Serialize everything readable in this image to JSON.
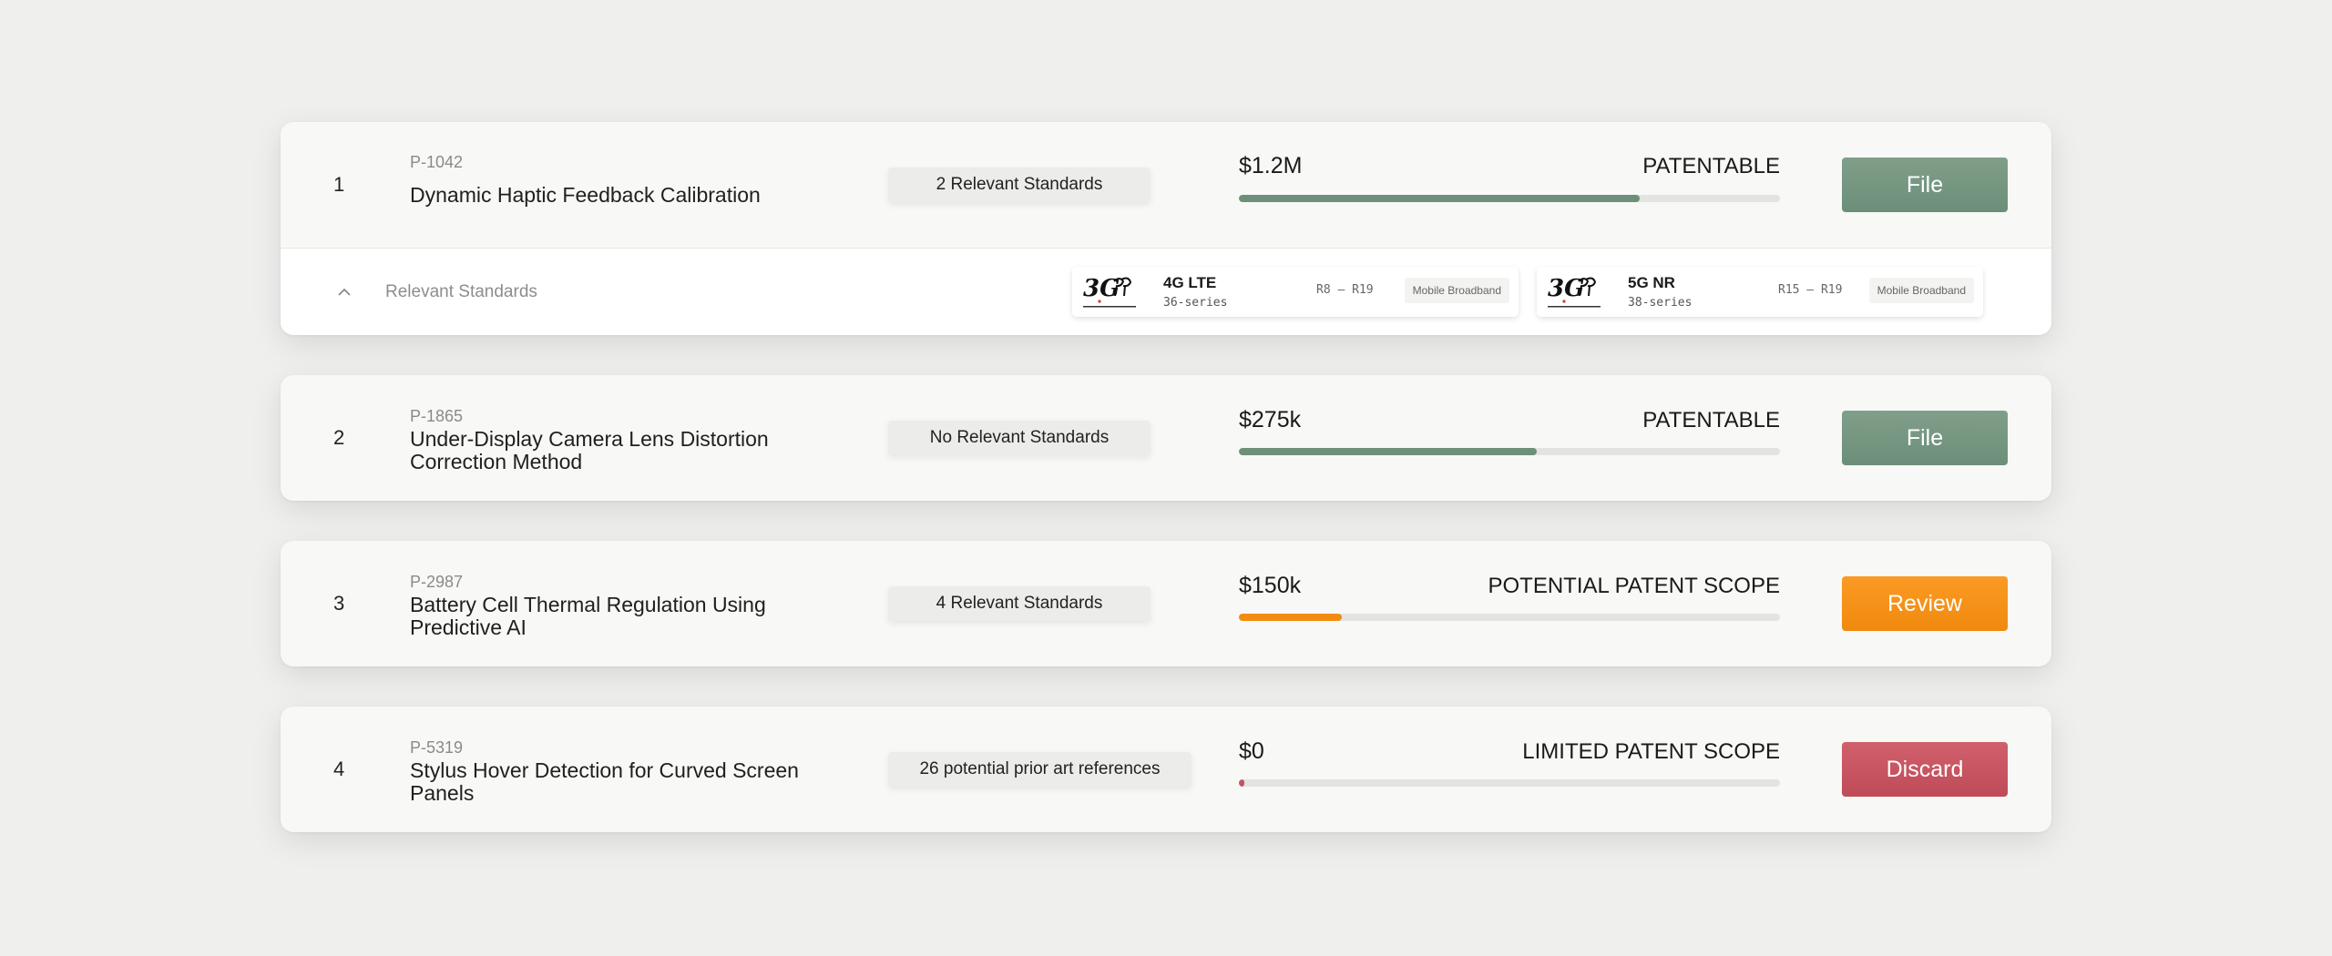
{
  "rows": [
    {
      "rank": "1",
      "id": "P-1042",
      "title": "Dynamic Haptic Feedback Calibration",
      "standards": "2 Relevant Standards",
      "value": "$1.2M",
      "verdict": "PATENTABLE",
      "progress": 0.74,
      "action": "File",
      "accent": "#6e8f79"
    },
    {
      "rank": "2",
      "id": "P-1865",
      "title": "Under-Display Camera Lens Distortion Correction Method",
      "standards": "No Relevant Standards",
      "value": "$275k",
      "verdict": "PATENTABLE",
      "progress": 0.55,
      "action": "File",
      "accent": "#6e8f79"
    },
    {
      "rank": "3",
      "id": "P-2987",
      "title": "Battery Cell Thermal Regulation Using Predictive AI",
      "standards": "4 Relevant Standards",
      "value": "$150k",
      "verdict": "POTENTIAL PATENT SCOPE",
      "progress": 0.19,
      "action": "Review",
      "accent": "#f28c10"
    },
    {
      "rank": "4",
      "id": "P-5319",
      "title": "Stylus Hover Detection for Curved Screen Panels",
      "standards": "26 potential prior art references",
      "value": "$0",
      "verdict": "LIMITED PATENT SCOPE",
      "progress": 0.01,
      "action": "Discard",
      "accent": "#c65462"
    }
  ],
  "expanded": {
    "label": "Relevant Standards",
    "icon": "chevron-up-icon",
    "standards": [
      {
        "logo": "3GPP",
        "name": "4G LTE",
        "series": "36-series",
        "range": "R8 – R19",
        "tag": "Mobile Broadband"
      },
      {
        "logo": "3GPP",
        "name": "5G NR",
        "series": "38-series",
        "range": "R15 – R19",
        "tag": "Mobile Broadband"
      }
    ]
  },
  "colors": {
    "file_button": "#6e8f79",
    "review_button": "#f28c10",
    "discard_button": "#c65462",
    "track": "#e3e3e1"
  }
}
